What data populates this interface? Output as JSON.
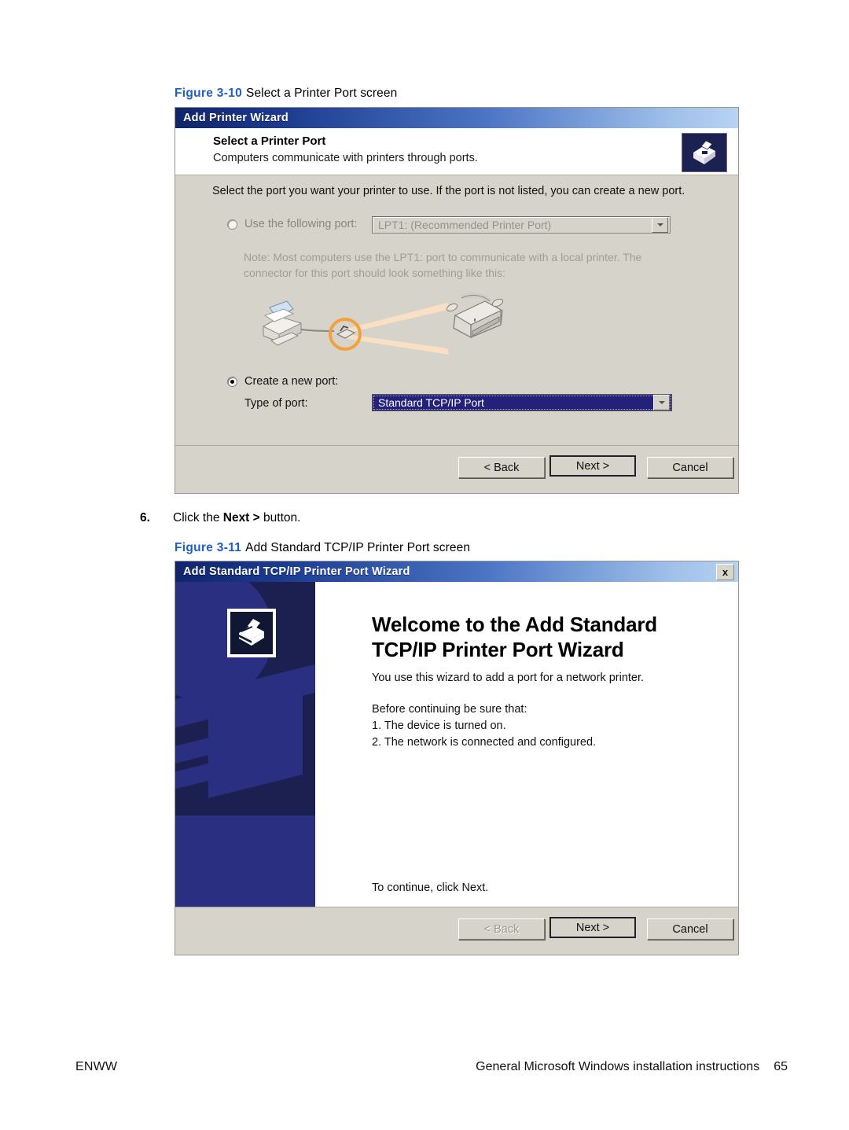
{
  "page": {
    "footer_left": "ENWW",
    "footer_right": "General Microsoft Windows installation instructions",
    "page_number": "65"
  },
  "figure_310": {
    "label": "Figure 3-10",
    "title": "Select a Printer Port screen"
  },
  "step6": {
    "number": "6.",
    "text_before": "Click the ",
    "bold": "Next >",
    "text_after": " button."
  },
  "figure_311": {
    "label": "Figure 3-11",
    "title": "Add Standard TCP/IP Printer Port screen"
  },
  "printer_wizard": {
    "titlebar": "Add Printer Wizard",
    "header_title": "Select a Printer Port",
    "header_subtitle": "Computers communicate with printers through ports.",
    "header_icon": "printer-icon",
    "intro": "Select the port you want your printer to use.  If the port is not listed, you can create a new port.",
    "use_following_port": {
      "label": "Use the following port:",
      "selected": false,
      "combo_value": "LPT1: (Recommended Printer Port)",
      "combo_enabled": false
    },
    "note": {
      "line1": "Note: Most computers use the LPT1: port to communicate with a local printer. The",
      "line2": "connector for this port should look something like this:"
    },
    "illustration": "printer-parallel-connector-illustration",
    "create_new_port": {
      "label": "Create a new port:",
      "selected": true,
      "type_label": "Type of port:",
      "combo_value": "Standard TCP/IP Port",
      "combo_selected": true
    },
    "buttons": {
      "back": "< Back",
      "next": "Next >",
      "cancel": "Cancel",
      "back_disabled": false,
      "next_default": true
    }
  },
  "tcpip_wizard": {
    "titlebar": "Add Standard TCP/IP Printer Port Wizard",
    "close_label": "x",
    "side_icon": "printer-icon",
    "heading_line1": "Welcome to the Add Standard",
    "heading_line2": "TCP/IP Printer Port Wizard",
    "paragraph": "You use this wizard to add a port for a network printer.",
    "before_continuing": "Before continuing be sure that:",
    "list": [
      "1.  The device is turned on.",
      "2.  The network is connected and configured."
    ],
    "continue_text": "To continue, click Next.",
    "buttons": {
      "back": "< Back",
      "next": "Next >",
      "cancel": "Cancel",
      "back_disabled": true,
      "next_default": true
    }
  },
  "colors": {
    "accent_blue": "#1f5ec4",
    "title_navy": "#10246b",
    "dialog_face": "#d6d3cb",
    "panel_dark": "#1c2050",
    "panel_mid": "#2b2f82",
    "combo_selected": "#23217a"
  }
}
